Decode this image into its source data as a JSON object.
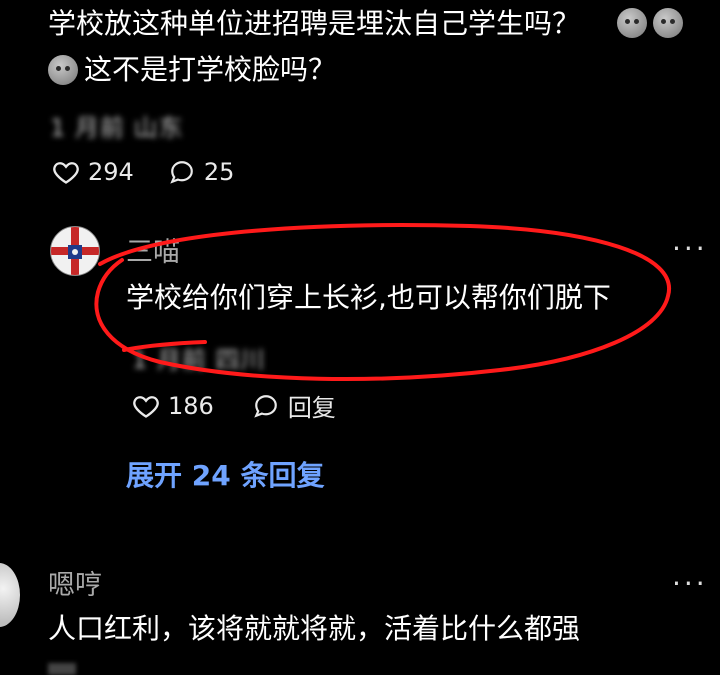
{
  "top_comment": {
    "text_line1": "学校放这种单位进招聘是埋汰自己学生吗？",
    "emoji_line1_a": "sad-face-emoji",
    "emoji_line1_b": "sad-face-emoji",
    "emoji_line2": "sad-face-emoji",
    "text_line2": "这不是打学校脸吗？",
    "blurred_meta": "1 月前 山东",
    "likes": "294",
    "replies": "25"
  },
  "reply": {
    "username": "三喵",
    "text": "学校给你们穿上长衫,也可以帮你们脱下",
    "blurred_meta": "1 月前 四川",
    "likes": "186",
    "reply_label": "回复",
    "more": "···",
    "expand_label": "展开 24 条回复"
  },
  "bottom_comment": {
    "username": "嗯哼",
    "text": "人口红利，该将就就将就，活着比什么都强",
    "more": "···"
  },
  "colors": {
    "background": "#000000",
    "link": "#6fa3ff",
    "annotation": "#ff0000"
  }
}
